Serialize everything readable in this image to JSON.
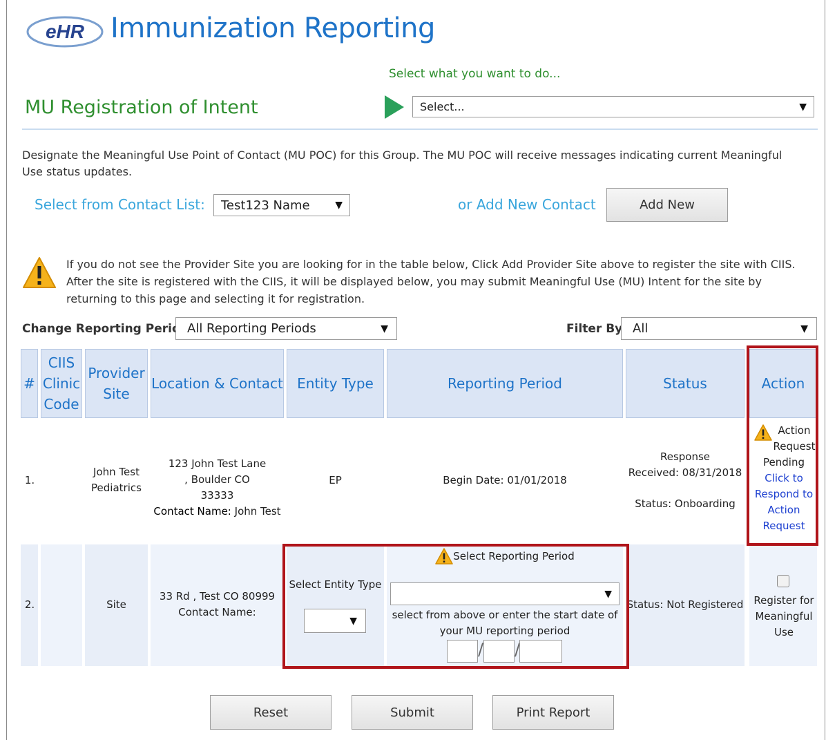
{
  "header": {
    "logo_text": "eHR",
    "app_title": "Immunization Reporting",
    "select_prompt": "Select what you want to do...",
    "section_title": "MU Registration of Intent",
    "action_select_value": "Select..."
  },
  "intro": {
    "description": "Designate the Meaningful Use Point of Contact (MU POC) for this Group. The MU POC will receive messages indicating current Meaningful Use status updates.",
    "contact_list_label": "Select from Contact List:",
    "contact_list_value": "Test123 Name",
    "add_contact_label": "or Add New Contact",
    "add_new_button": "Add New"
  },
  "notice": {
    "text": "If you do not see the Provider Site you are looking for in the table below, Click Add Provider Site above to register the site with CIIS. After the site is registered with the CIIS, it will be displayed below, you may submit Meaningful Use (MU) Intent for the site by returning to this page and selecting it for registration."
  },
  "filters": {
    "period_label": "Change Reporting Period:",
    "period_value": "All Reporting Periods",
    "filter_label": "Filter By:",
    "filter_value": "All"
  },
  "table": {
    "headers": {
      "num": "#",
      "clinic_code": "CIIS Clinic Code",
      "provider_site": "Provider Site",
      "location": "Location & Contact",
      "entity_type": "Entity Type",
      "reporting_period": "Reporting Period",
      "status": "Status",
      "action": "Action"
    },
    "rows": [
      {
        "num": "1.",
        "clinic_code": "",
        "provider_site": "John Test Pediatrics",
        "location": "123 John Test Lane , Boulder CO 33333",
        "contact_label": "Contact Name:",
        "contact_name": "John Test",
        "entity_type": "EP",
        "reporting_period": "Begin Date: 01/01/2018",
        "response_label": "Response",
        "received": "Received: 08/31/2018",
        "status_label": "Status:",
        "status_value": "Onboarding",
        "action_pending": "Action Request Pending",
        "action_link": "Click to Respond to Action Request"
      },
      {
        "num": "2.",
        "clinic_code": "",
        "provider_site": "Site",
        "location": "33 Rd , Test CO 80999",
        "contact_label": "Contact Name:",
        "contact_name": "",
        "entity_type_label": "Select Entity Type",
        "reporting_period_label": "Select Reporting Period",
        "reporting_period_help": "select from above or enter the start date of your MU reporting period",
        "date_separator": "/",
        "status_label": "Status:",
        "status_value": "Not Registered",
        "action_label": "Register for Meaningful Use"
      }
    ]
  },
  "buttons": {
    "reset": "Reset",
    "submit": "Submit",
    "print": "Print Report"
  },
  "colors": {
    "accent_blue": "#1e73c8",
    "accent_green": "#2f8f2f",
    "highlight_red": "#b0141a",
    "header_bg": "#dbe5f5"
  }
}
